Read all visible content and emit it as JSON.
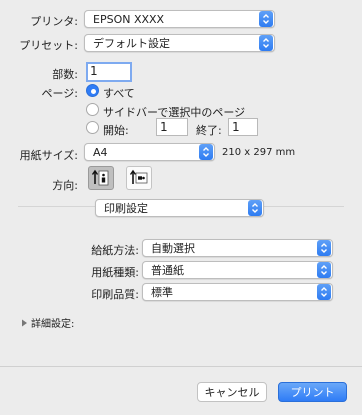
{
  "printer": {
    "label": "プリンタ:",
    "value": "EPSON XXXX"
  },
  "preset": {
    "label": "プリセット:",
    "value": "デフォルト設定"
  },
  "copies": {
    "label": "部数:",
    "value": "1"
  },
  "pages": {
    "label": "ページ:",
    "option_all": "すべて",
    "option_selection": "サイドバーで選択中のページ",
    "option_range_start": "開始:",
    "start_value": "1",
    "end_label": "終了:",
    "end_value": "1"
  },
  "paper_size": {
    "label": "用紙サイズ:",
    "value": "A4",
    "dimensions": "210 x 297 mm"
  },
  "orientation": {
    "label": "方向:"
  },
  "section_popup": {
    "value": "印刷設定"
  },
  "paper_source": {
    "label": "給紙方法:",
    "value": "自動選択"
  },
  "paper_type": {
    "label": "用紙種類:",
    "value": "普通紙"
  },
  "print_quality": {
    "label": "印刷品質:",
    "value": "標準"
  },
  "advanced": {
    "label": "詳細設定:"
  },
  "buttons": {
    "cancel": "キャンセル",
    "print": "プリント"
  },
  "colors": {
    "accent": "#2f7cf6",
    "background": "#ececec"
  }
}
